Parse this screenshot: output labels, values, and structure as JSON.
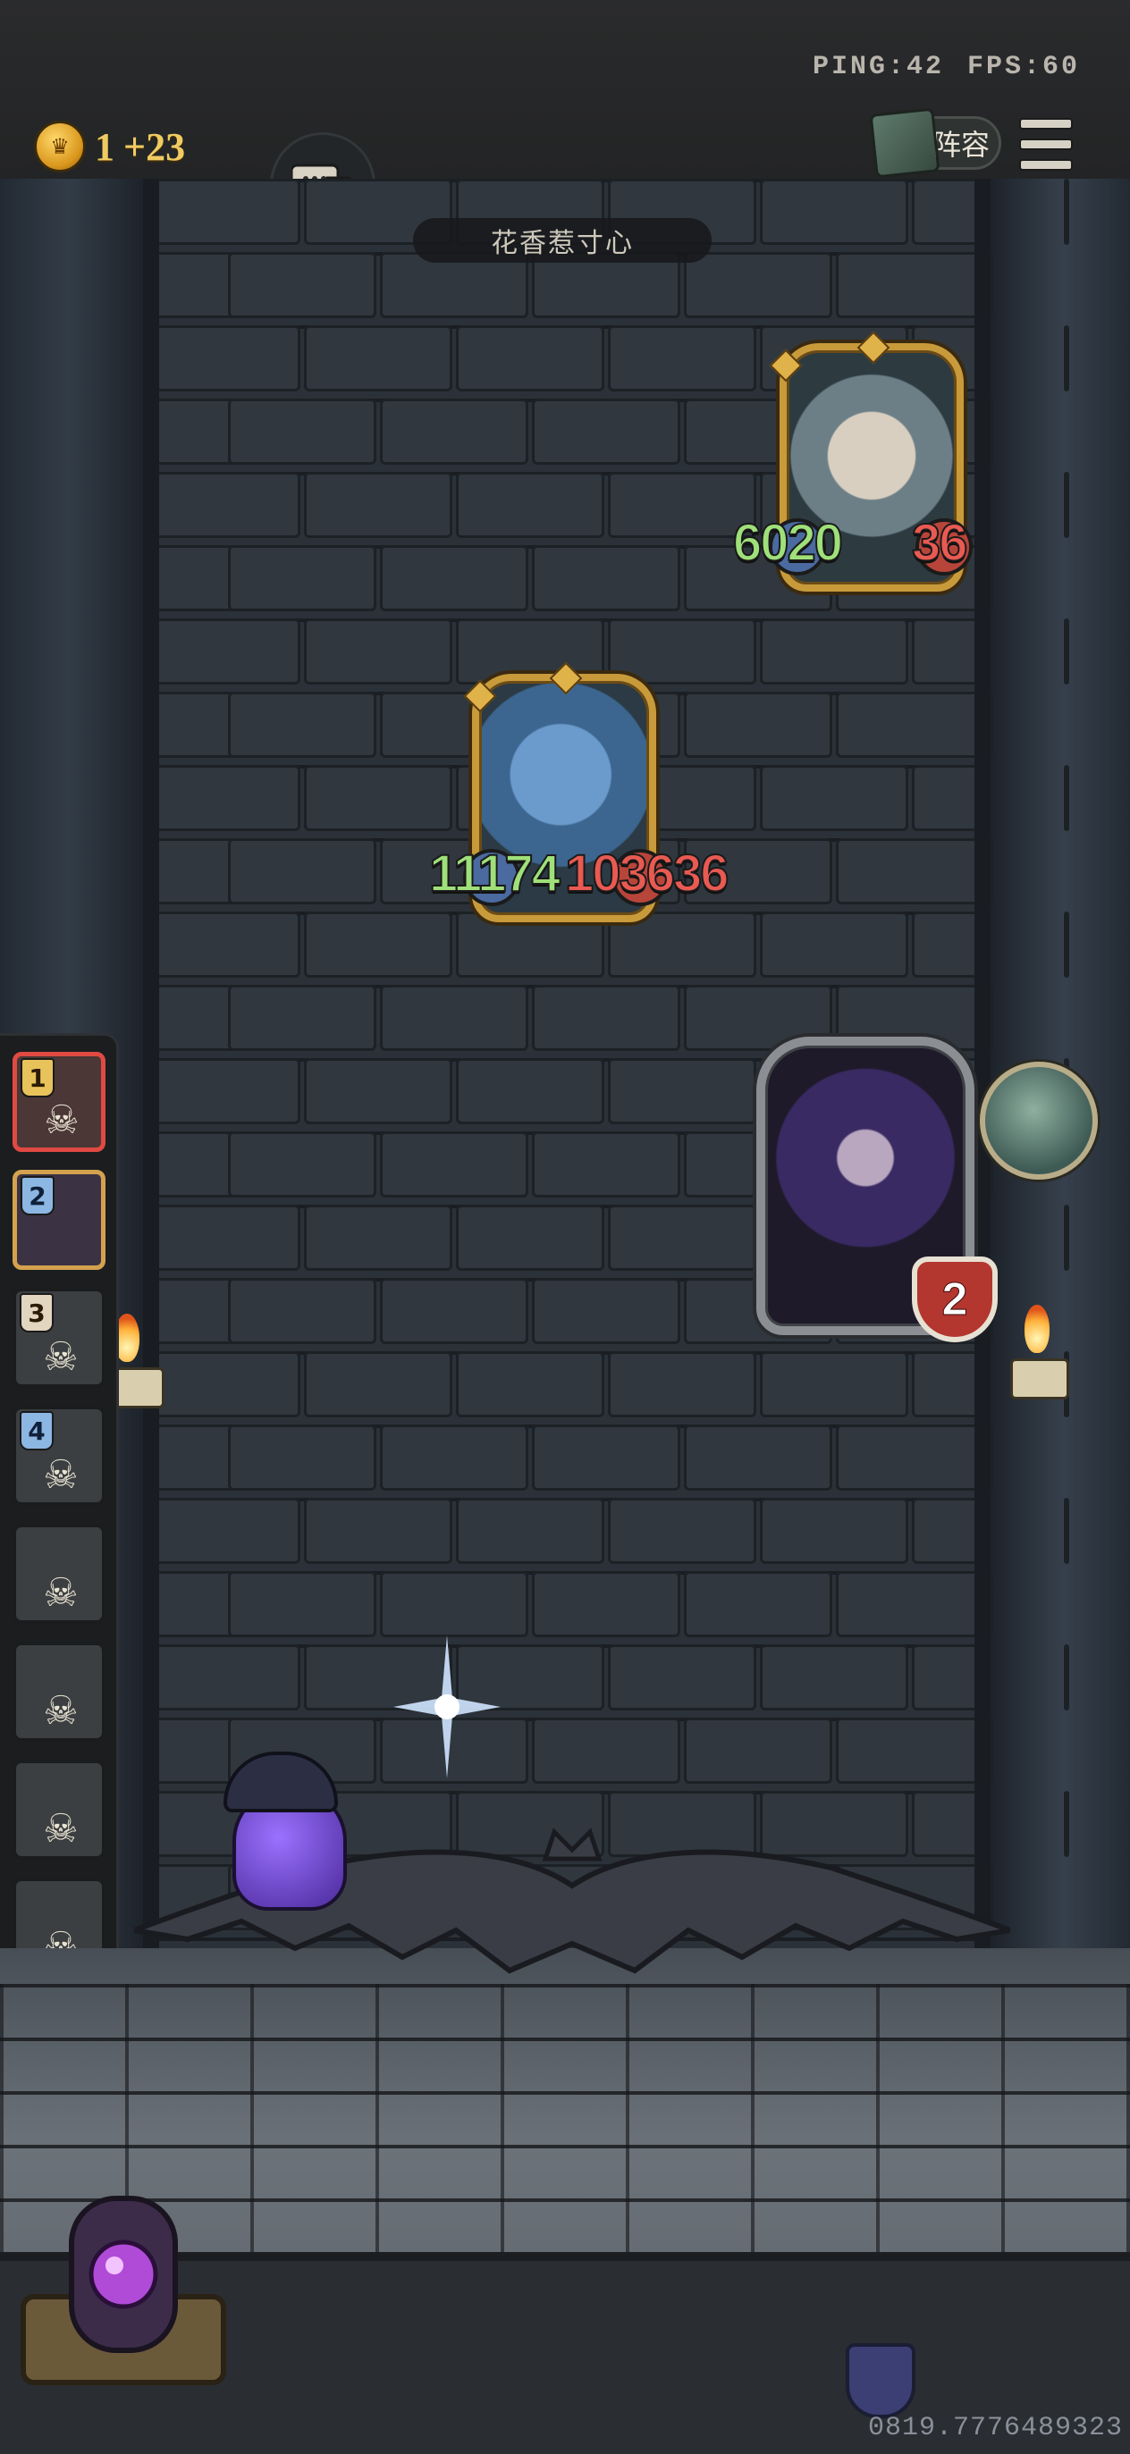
{
  "status": {
    "ping": "PING:42",
    "fps": "FPS:60"
  },
  "currency": {
    "amount": "1",
    "gain": "+23"
  },
  "header": {
    "lineup_label": "阵容"
  },
  "stage": {
    "title": "花香惹寸心"
  },
  "enemies": [
    {
      "name": "yeti",
      "attack": "6020",
      "health": "36"
    },
    {
      "name": "dragon",
      "attack": "11174",
      "health": "103636"
    }
  ],
  "player_card": {
    "name": "dark-elf",
    "health": "2"
  },
  "queue": [
    {
      "num": "1",
      "state": "active"
    },
    {
      "num": "2",
      "state": "next"
    },
    {
      "num": "3",
      "state": "dead"
    },
    {
      "num": "4",
      "state": "dead"
    },
    {
      "num": "",
      "state": "dead"
    },
    {
      "num": "",
      "state": "dead"
    },
    {
      "num": "",
      "state": "dead"
    },
    {
      "num": "",
      "state": "dead"
    }
  ],
  "icons": {
    "coin": "crown-coin-icon",
    "chat": "chat-bubbles-icon",
    "menu": "hamburger-menu-icon",
    "skull": "skull-icon",
    "shield": "shield-icon"
  },
  "colors": {
    "attack": "#9fe07a",
    "health": "#e85a52",
    "active_border": "#e04a42"
  },
  "footer": {
    "uid": "0819.7776489323"
  }
}
